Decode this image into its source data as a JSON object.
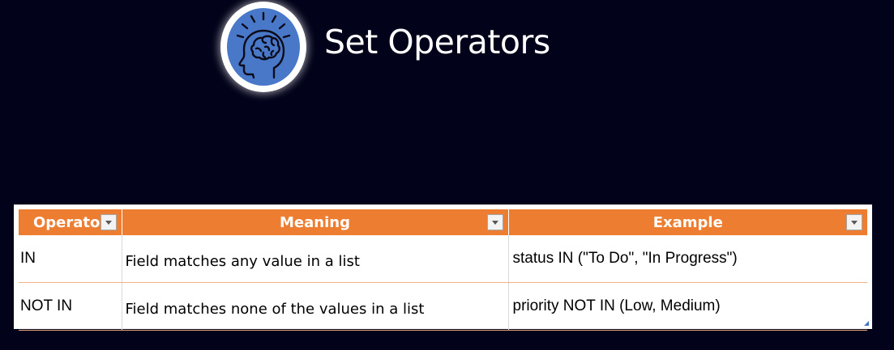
{
  "header": {
    "title": "Set Operators",
    "logo_icon": "brain-head-icon",
    "logo_color": "#4a78c8"
  },
  "table": {
    "header_color": "#ed7d31",
    "columns": [
      {
        "label": "Operato",
        "filter_icon": "filter-dropdown-icon"
      },
      {
        "label": "Meaning",
        "filter_icon": "filter-dropdown-icon"
      },
      {
        "label": "Example",
        "filter_icon": "filter-dropdown-icon"
      }
    ],
    "rows": [
      {
        "operator": "IN",
        "meaning": "Field matches any value in a list",
        "example": "status IN (\"To Do\", \"In Progress\")"
      },
      {
        "operator": "NOT IN",
        "meaning": "Field matches none of the values in a list",
        "example": "priority NOT IN (Low, Medium)"
      }
    ]
  }
}
